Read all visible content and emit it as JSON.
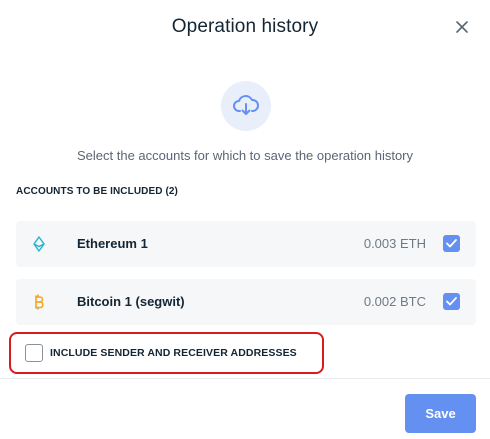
{
  "modal": {
    "title": "Operation history",
    "description": "Select the accounts for which to save the operation history",
    "section_label": "ACCOUNTS TO BE INCLUDED (2)"
  },
  "accounts": [
    {
      "name": "Ethereum 1",
      "balance": "0.003 ETH",
      "icon": "ethereum-icon",
      "color": "#29b6cf",
      "checked": true
    },
    {
      "name": "Bitcoin 1 (segwit)",
      "balance": "0.002 BTC",
      "icon": "bitcoin-icon",
      "color": "#f5a623",
      "checked": true
    }
  ],
  "include_addresses": {
    "label": "INCLUDE SENDER AND RECEIVER ADDRESSES",
    "checked": false
  },
  "footer": {
    "save_label": "Save"
  },
  "colors": {
    "accent": "#6490f1",
    "highlight": "#d61c1c"
  }
}
